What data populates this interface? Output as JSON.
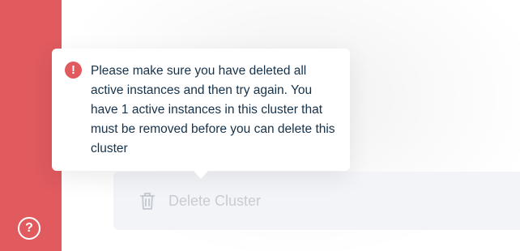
{
  "sidebar": {
    "help_icon": "?"
  },
  "tooltip": {
    "alert_icon": "!",
    "message": "Please make sure you have deleted all active instances and then try again. You have 1 active instances in this cluster that must be removed before you can delete this cluster"
  },
  "actions": {
    "delete_cluster_label": "Delete Cluster"
  },
  "colors": {
    "sidebar": "#e05a5e",
    "alert": "#e05a5e",
    "text": "#16324a",
    "disabled_text": "#c7cbd3"
  }
}
